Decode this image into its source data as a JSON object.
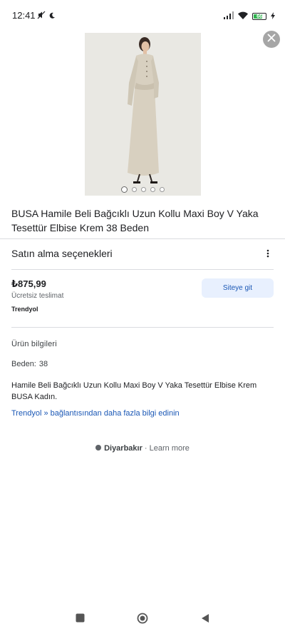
{
  "status_bar": {
    "time": "12:41",
    "battery": "66",
    "icons": [
      "muted-icon",
      "moon-icon",
      "signal-icon",
      "wifi-icon",
      "battery-icon",
      "charging-icon"
    ]
  },
  "product": {
    "title": "BUSA Hamile Beli Bağcıklı Uzun Kollu Maxi Boy V Yaka Tesettür Elbise Krem 38 Beden",
    "image_count": 5,
    "active_image": 0
  },
  "purchase": {
    "section_title": "Satın alma seçenekleri",
    "price": "₺875,99",
    "shipping": "Ücretsiz teslimat",
    "seller": "Trendyol",
    "visit_button": "Siteye git"
  },
  "info": {
    "section_title": "Ürün bilgileri",
    "size_label": "Beden:",
    "size_value": "38",
    "description": "Hamile Beli Bağcıklı Uzun Kollu Maxi Boy V Yaka Tesettür Elbise Krem BUSA Kadın.",
    "more_link": "Trendyol » bağlantısından daha fazla bilgi edinin"
  },
  "footer": {
    "location": "Diyarbakır",
    "separator": " · ",
    "learn_more": "Learn more"
  },
  "colors": {
    "link": "#1a57b5",
    "button_bg": "#e8f0fe",
    "divider": "#dadce0"
  }
}
